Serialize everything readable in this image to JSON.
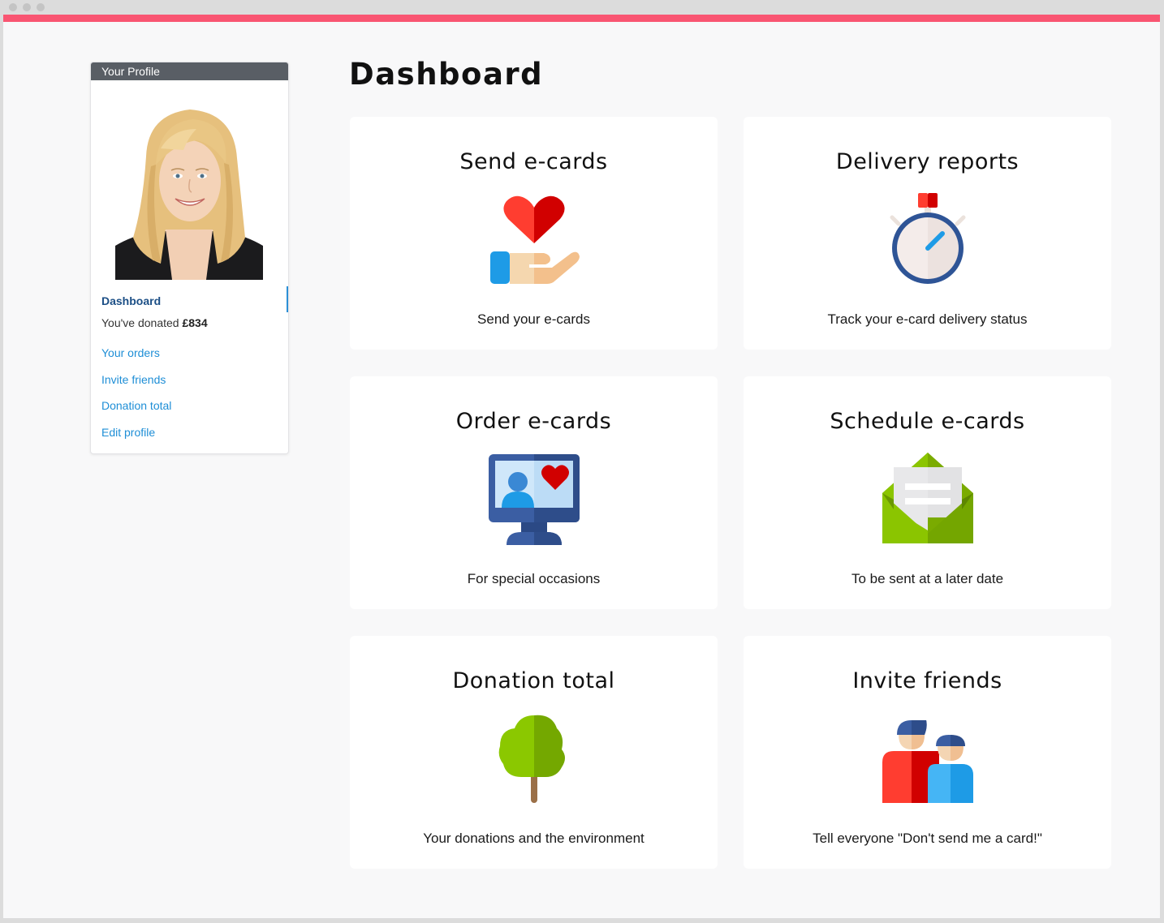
{
  "colors": {
    "accent_bar": "#f95572",
    "profile_header": "#595e65",
    "link": "#1e8ed6",
    "active_nav": "#1c4f86"
  },
  "profile": {
    "header": "Your Profile",
    "active_item": "Dashboard",
    "donated_prefix": "You've donated ",
    "donated_amount": "£834",
    "links": [
      {
        "label": "Your orders"
      },
      {
        "label": "Invite friends"
      },
      {
        "label": "Donation total"
      },
      {
        "label": "Edit profile"
      }
    ]
  },
  "page": {
    "title": "Dashboard"
  },
  "tiles": [
    {
      "title": "Send e-cards",
      "icon": "heart-in-hand-icon",
      "desc": "Send your e-cards"
    },
    {
      "title": "Delivery reports",
      "icon": "stopwatch-icon",
      "desc": "Track your e-card delivery status"
    },
    {
      "title": "Order e-cards",
      "icon": "monitor-heart-icon",
      "desc": "For special occasions"
    },
    {
      "title": "Schedule e-cards",
      "icon": "envelope-letter-icon",
      "desc": "To be sent at a later date"
    },
    {
      "title": "Donation total",
      "icon": "tree-icon",
      "desc": "Your donations and the environment"
    },
    {
      "title": "Invite friends",
      "icon": "friends-icon",
      "desc": "Tell everyone \"Don't send me a card!\""
    }
  ]
}
